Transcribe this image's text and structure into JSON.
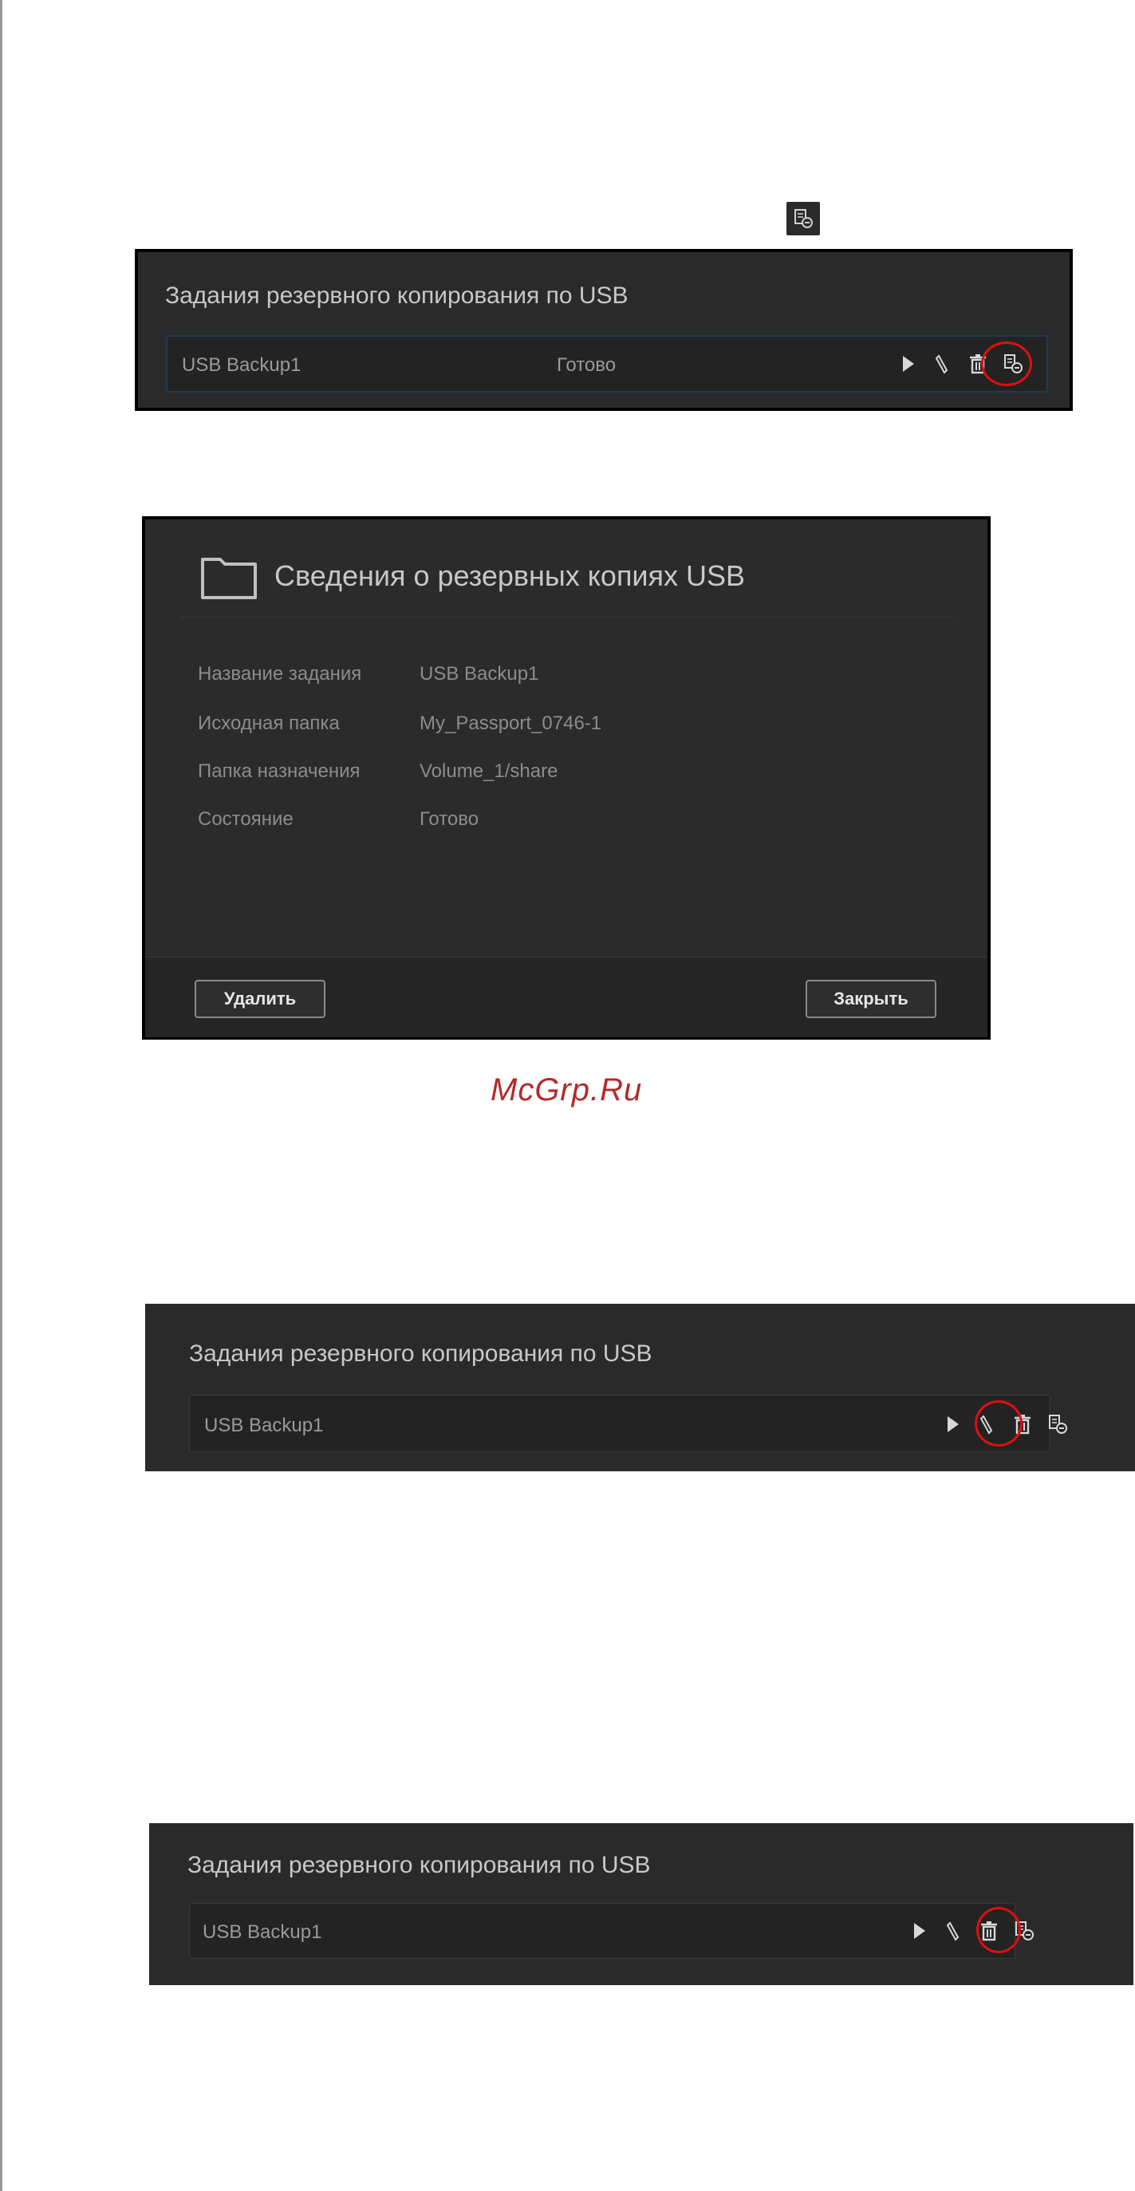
{
  "panel_top": {
    "title": "Задания резервного копирования по USB",
    "job": {
      "name": "USB Backup1",
      "status": "Готово"
    },
    "highlighted_action": "details-icon"
  },
  "details_dialog": {
    "title": "Сведения о резервных копиях USB",
    "fields": [
      {
        "label": "Название задания",
        "value": "USB Backup1"
      },
      {
        "label": "Исходная папка",
        "value": "My_Passport_0746-1"
      },
      {
        "label": "Папка назначения",
        "value": "Volume_1/share"
      },
      {
        "label": "Состояние",
        "value": "Готово"
      }
    ],
    "delete_label": "Удалить",
    "close_label": "Закрыть"
  },
  "watermark": "McGrp.Ru",
  "panel_middle": {
    "title": "Задания резервного копирования по USB",
    "job": {
      "name": "USB Backup1"
    },
    "highlighted_action": "edit-icon"
  },
  "panel_bottom": {
    "title": "Задания резервного копирования по USB",
    "job": {
      "name": "USB Backup1"
    },
    "highlighted_action": "trash-icon"
  },
  "colors": {
    "highlight_ring": "#e01010",
    "panel_bg": "#2a2a2a",
    "row_bg": "#232323",
    "watermark": "#b22a2a"
  },
  "action_icons": [
    "play-icon",
    "edit-icon",
    "trash-icon",
    "details-icon"
  ]
}
